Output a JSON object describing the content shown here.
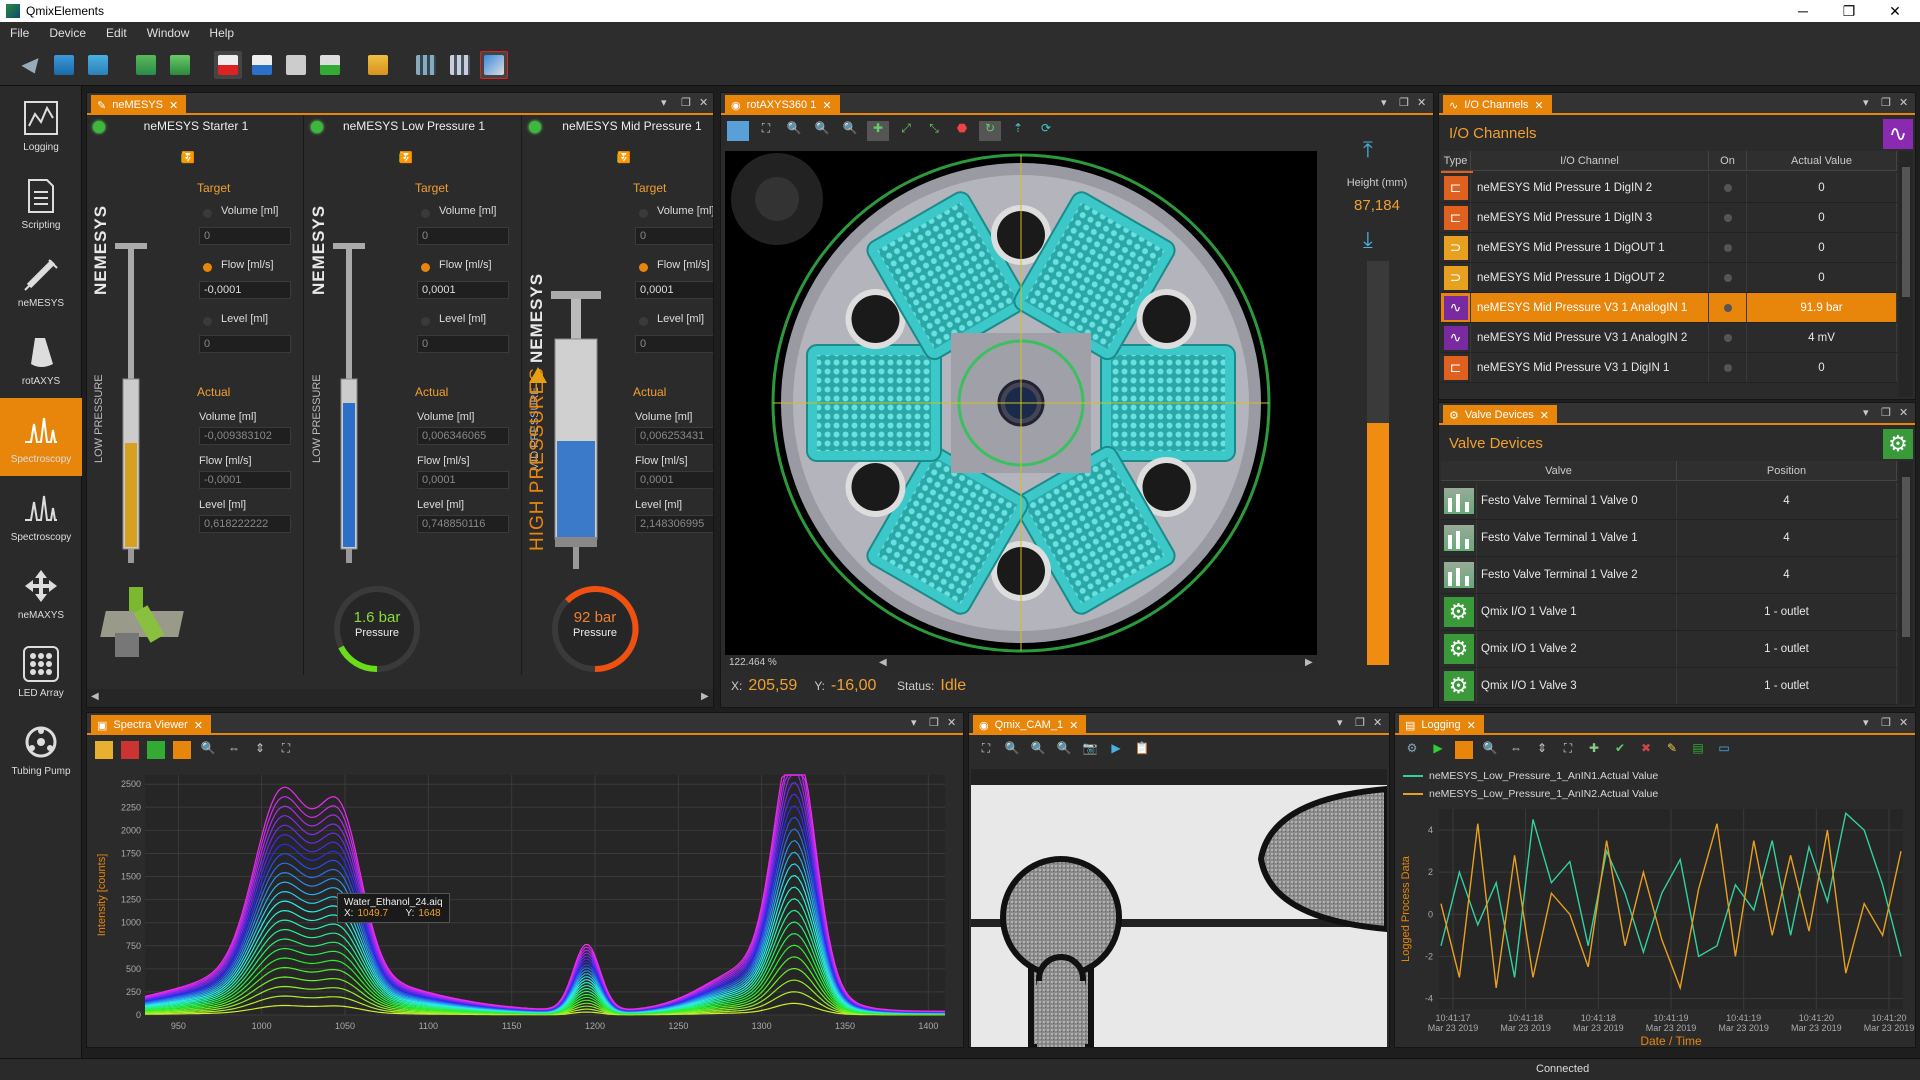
{
  "window": {
    "title": "QmixElements",
    "minimize": "─",
    "restore": "❐",
    "close": "✕"
  },
  "menu": [
    "File",
    "Device",
    "Edit",
    "Window",
    "Help"
  ],
  "sidebar": [
    {
      "label": "Logging"
    },
    {
      "label": "Scripting"
    },
    {
      "label": "neMESYS"
    },
    {
      "label": "rotAXYS"
    },
    {
      "label": "Spectroscopy"
    },
    {
      "label": "Spectroscopy"
    },
    {
      "label": "neMAXYS"
    },
    {
      "label": "LED Array"
    },
    {
      "label": "Tubing Pump"
    }
  ],
  "nemesys_panel": {
    "tab": "neMESYS",
    "pumps": [
      {
        "name": "neMESYS Starter 1",
        "brand": "NEMESYS",
        "type": "LOW PRESSURE",
        "target_label": "Target",
        "volume_label": "Volume [ml]",
        "volume": "0",
        "flow_label": "Flow [ml/s]",
        "flow": "-0,0001",
        "level_label": "Level [ml]",
        "level": "0",
        "actual_label": "Actual",
        "a_volume_label": "Volume [ml]",
        "a_volume": "-0,009383102",
        "a_flow_label": "Flow [ml/s]",
        "a_flow": "-0,0001",
        "a_level_label": "Level [ml]",
        "a_level": "0,618222222"
      },
      {
        "name": "neMESYS Low Pressure 1",
        "brand": "NEMESYS",
        "type": "LOW PRESSURE",
        "target_label": "Target",
        "volume_label": "Volume [ml]",
        "volume": "0",
        "flow_label": "Flow [ml/s]",
        "flow": "0,0001",
        "level_label": "Level [ml]",
        "level": "0",
        "actual_label": "Actual",
        "a_volume_label": "Volume [ml]",
        "a_volume": "0,006346065",
        "a_flow_label": "Flow [ml/s]",
        "a_flow": "0,0001",
        "a_level_label": "Level [ml]",
        "a_level": "0,748850116",
        "gauge_value": "1.6 bar",
        "gauge_label": "Pressure"
      },
      {
        "name": "neMESYS Mid Pressure 1",
        "brand": "NEMESYS",
        "type": "MID PRESSURE",
        "warn": "HIGH PRESSURES",
        "target_label": "Target",
        "volume_label": "Volume [ml]",
        "volume": "0",
        "flow_label": "Flow [ml/s]",
        "flow": "0,0001",
        "level_label": "Level [ml]",
        "level": "0",
        "actual_label": "Actual",
        "a_volume_label": "Volume [ml]",
        "a_volume": "0,006253431",
        "a_flow_label": "Flow [ml/s]",
        "a_flow": "0,0001",
        "a_level_label": "Level [ml]",
        "a_level": "2,148306995",
        "gauge_value": "92 bar",
        "gauge_label": "Pressure"
      }
    ]
  },
  "rotaxys": {
    "tab": "rotAXYS360 1",
    "zoom": "122.464 %",
    "x_label": "X:",
    "x": "205,59",
    "y_label": "Y:",
    "y": "-16,00",
    "status_label": "Status:",
    "status": "Idle",
    "height_label": "Height (mm)",
    "height": "87,184",
    "height_fill": 0.6
  },
  "io_channels": {
    "tab": "I/O Channels",
    "title": "I/O Channels",
    "headers": [
      "Type",
      "I/O Channel",
      "On",
      "Actual Value"
    ],
    "rows": [
      {
        "name": "neMESYS Mid Pressure 1 DigIN 2",
        "value": "0",
        "kind": "digin"
      },
      {
        "name": "neMESYS Mid Pressure 1 DigIN 3",
        "value": "0",
        "kind": "digin"
      },
      {
        "name": "neMESYS Mid Pressure 1 DigOUT 1",
        "value": "0",
        "kind": "digout"
      },
      {
        "name": "neMESYS Mid Pressure 1 DigOUT 2",
        "value": "0",
        "kind": "digout"
      },
      {
        "name": "neMESYS Mid Pressure V3 1 AnalogIN 1",
        "value": "91.9 bar",
        "kind": "analog",
        "selected": true
      },
      {
        "name": "neMESYS Mid Pressure V3 1 AnalogIN 2",
        "value": "4 mV",
        "kind": "analog2"
      },
      {
        "name": "neMESYS Mid Pressure V3 1 DigIN 1",
        "value": "0",
        "kind": "digin"
      }
    ]
  },
  "valves": {
    "tab": "Valve Devices",
    "title": "Valve Devices",
    "headers": [
      "Valve",
      "Position"
    ],
    "rows": [
      {
        "name": "Festo Valve Terminal 1 Valve 0",
        "pos": "4",
        "kind": "festo"
      },
      {
        "name": "Festo Valve Terminal 1 Valve 1",
        "pos": "4",
        "kind": "festo"
      },
      {
        "name": "Festo Valve Terminal 1 Valve 2",
        "pos": "4",
        "kind": "festo"
      },
      {
        "name": "Qmix I/O 1 Valve 1",
        "pos": "1 - outlet",
        "kind": "qmix"
      },
      {
        "name": "Qmix I/O 1 Valve 2",
        "pos": "1 - outlet",
        "kind": "qmix"
      },
      {
        "name": "Qmix I/O 1 Valve 3",
        "pos": "1 - outlet",
        "kind": "qmix"
      }
    ]
  },
  "spectra": {
    "tab": "Spectra Viewer",
    "tooltip_name": "Water_Ethanol_24.aiq",
    "tooltip_x_label": "X:",
    "tooltip_x": "1049.7",
    "tooltip_y_label": "Y:",
    "tooltip_y": "1648"
  },
  "camera": {
    "tab": "Qmix_CAM_1"
  },
  "logging": {
    "tab": "Logging",
    "legend": [
      "neMESYS_Low_Pressure_1_AnIN1.Actual Value",
      "neMESYS_Low_Pressure_1_AnIN2.Actual Value"
    ]
  },
  "status": {
    "text": "Connected"
  },
  "chart_data": [
    {
      "type": "line",
      "title": "",
      "xlabel": "",
      "ylabel": "Intensity [counts]",
      "xlim": [
        930,
        1410
      ],
      "ylim": [
        0,
        2600
      ],
      "x_ticks": [
        "950",
        "1000",
        "1050",
        "1100",
        "1150",
        "1200",
        "1250",
        "1300",
        "1350",
        "1400"
      ],
      "y_ticks": [
        "0",
        "250",
        "500",
        "750",
        "1000",
        "1250",
        "1500",
        "1750",
        "2000",
        "2250",
        "2500"
      ],
      "peaks": [
        {
          "center": 1012,
          "width": 16,
          "height": 1880
        },
        {
          "center": 1047,
          "width": 13,
          "height": 1650
        },
        {
          "center": 1020,
          "width": 60,
          "height": 500
        },
        {
          "center": 1195,
          "width": 8,
          "height": 720
        },
        {
          "center": 1320,
          "width": 12,
          "height": 2600
        },
        {
          "center": 1298,
          "width": 30,
          "height": 500
        }
      ],
      "series_count": 24,
      "grid": true
    },
    {
      "type": "line",
      "title": "",
      "xlabel": "Date / Time",
      "ylabel": "Logged Process Data",
      "ylim": [
        -4.5,
        5
      ],
      "y_ticks": [
        "-4",
        "-2",
        "0",
        "2",
        "4"
      ],
      "x_ticks": [
        "10:41:17\nMar 23 2019",
        "10:41:18\nMar 23 2019",
        "10:41:18\nMar 23 2019",
        "10:41:19\nMar 23 2019",
        "10:41:19\nMar 23 2019",
        "10:41:20\nMar 23 2019",
        "10:41:20\nMar 23 2019"
      ],
      "series": [
        {
          "name": "neMESYS_Low_Pressure_1_AnIN1.Actual Value",
          "color": "#33d0a0",
          "values": [
            -1.5,
            2.0,
            -0.5,
            1.5,
            -3.0,
            4.5,
            1.5,
            2.5,
            -1.5,
            3.0,
            1.0,
            -1.8,
            1.0,
            2.6,
            -2.0,
            -1.5,
            1.4,
            0.2,
            3.5,
            -1.0,
            3.2,
            0.6,
            4.8,
            4.0,
            1.4,
            -2.0
          ]
        },
        {
          "name": "neMESYS_Low_Pressure_1_AnIN2.Actual Value",
          "color": "#e8a020",
          "values": [
            0.5,
            -3.0,
            4.3,
            -3.5,
            2.8,
            -3.0,
            1.0,
            0.0,
            -2.5,
            3.5,
            -1.5,
            2.0,
            -1.2,
            -3.5,
            1.2,
            4.3,
            -2.0,
            3.5,
            -1.0,
            2.8,
            -0.8,
            4.0,
            -2.8,
            0.5,
            -1.0,
            3.0
          ]
        }
      ],
      "grid": true
    }
  ]
}
